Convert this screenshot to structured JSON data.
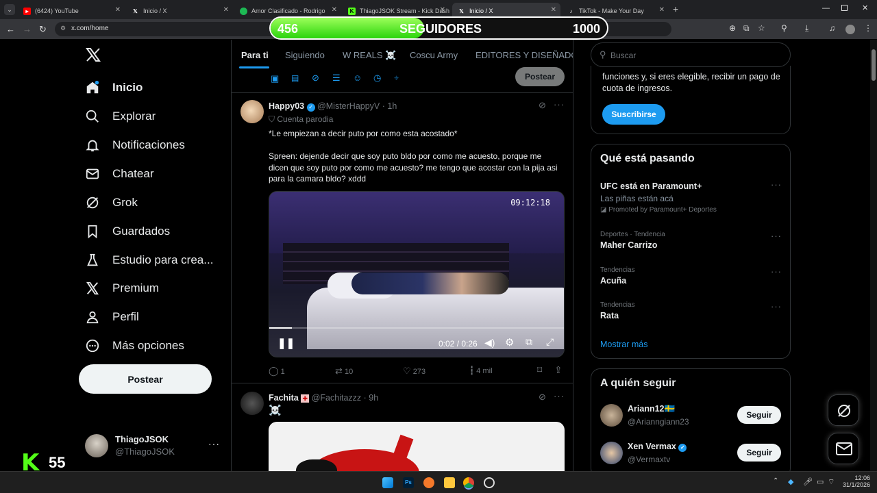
{
  "browser": {
    "tabs": [
      {
        "title": "(6424) YouTube",
        "color": "#ff0000",
        "icon": "youtube-icon"
      },
      {
        "title": "Inicio / X",
        "color": "#ffffff",
        "icon": "x-logo-icon"
      },
      {
        "title": "Amor Clasificado - Rodrigo",
        "color": "#1db954",
        "icon": "spotify-icon"
      },
      {
        "title": "ThiagoJSOK Stream - Kick Dash",
        "color": "#53fc18",
        "icon": "kick-icon"
      },
      {
        "title": "Inicio / X",
        "color": "#ffffff",
        "icon": "x-logo-icon"
      },
      {
        "title": "TikTok - Make Your Day",
        "color": "#ffffff",
        "icon": "tiktok-icon"
      }
    ],
    "url": "x.com/home"
  },
  "followers": {
    "current": "456",
    "label": "SEGUIDORES",
    "goal": "1000",
    "progress": 0.456,
    "color": "#53fc18"
  },
  "nav": {
    "items": [
      {
        "label": "Inicio",
        "icon": "home-icon"
      },
      {
        "label": "Explorar",
        "icon": "search-icon"
      },
      {
        "label": "Notificaciones",
        "icon": "bell-icon"
      },
      {
        "label": "Chatear",
        "icon": "mail-icon"
      },
      {
        "label": "Grok",
        "icon": "grok-icon"
      },
      {
        "label": "Guardados",
        "icon": "bookmark-icon"
      },
      {
        "label": "Estudio para crea...",
        "icon": "flask-icon"
      },
      {
        "label": "Premium",
        "icon": "x-logo-icon"
      },
      {
        "label": "Perfil",
        "icon": "person-icon"
      },
      {
        "label": "Más opciones",
        "icon": "more-circle-icon"
      }
    ],
    "post_label": "Postear",
    "account": {
      "name": "ThiagoJSOK",
      "handle": "@ThiagoJSOK"
    }
  },
  "feed": {
    "tabs": [
      "Para ti",
      "Siguiendo",
      "W REALS ☠️",
      "Coscu Army",
      "EDITORES Y DISEÑADOR"
    ],
    "compose_post_label": "Postear",
    "tweet1": {
      "name": "Happy03",
      "handle": "@MisterHappyV",
      "time": "· 1h",
      "badge": "Cuenta parodia",
      "line1": "*Le empiezan a decir puto por como esta acostado*",
      "line2": "Spreen: dejende decir que soy puto bldo por como me acuesto, porque me dicen que soy puto por como me acuesto? me tengo que acostar con la pija asi para la camara bldo? xddd",
      "video_timestamp": "09:12:18",
      "video_time": "0:02 / 0:26",
      "video_progress": 0.077,
      "replies": "1",
      "reposts": "10",
      "likes": "273",
      "views": "4 mil"
    },
    "tweet2": {
      "name": "Fachita",
      "handle": "@Fachitazzz",
      "time": "· 9h",
      "text": "☠️"
    }
  },
  "right": {
    "search_placeholder": "Buscar",
    "premium_text": "funciones y, si eres elegible, recibir un pago de cuota de ingresos.",
    "subscribe_label": "Suscribirse",
    "trending_title": "Qué está pasando",
    "trends": [
      {
        "meta": "",
        "name": "UFC está en Paramount+",
        "sub": "Las piñas están acá",
        "promo": "Promoted by Paramount+ Deportes"
      },
      {
        "meta": "Deportes · Tendencia",
        "name": "Maher Carrizo"
      },
      {
        "meta": "Tendencias",
        "name": "Acuña"
      },
      {
        "meta": "Tendencias",
        "name": "Rata"
      }
    ],
    "show_more": "Mostrar más",
    "follow_title": "A quién seguir",
    "follow": [
      {
        "name": "Ariann12🇸🇪",
        "handle": "@Arianngiann23",
        "button": "Seguir"
      },
      {
        "name": "Xen Vermax",
        "handle": "@Vermaxtv",
        "button": "Seguir"
      }
    ]
  },
  "overlay": {
    "kick_count": "55"
  },
  "taskbar": {
    "time": "12:06",
    "date": "31/1/2026"
  }
}
